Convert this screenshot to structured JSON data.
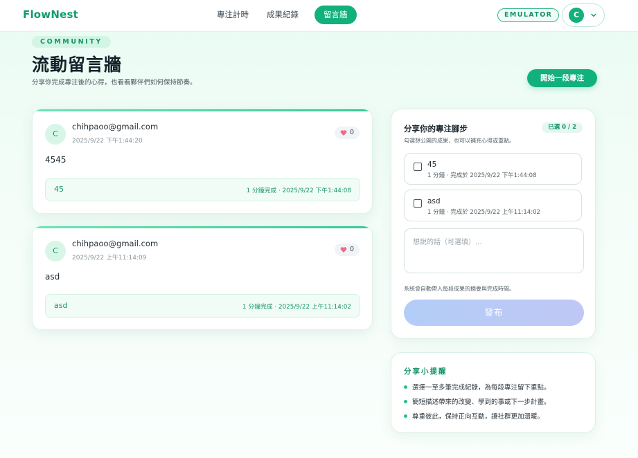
{
  "nav": {
    "brand": "FlowNest",
    "links": [
      "專注計時",
      "成果紀錄",
      "留言牆"
    ],
    "active_index": 2,
    "emulator_badge": "EMULATOR",
    "user_initial": "C"
  },
  "hero": {
    "eyebrow": "COMMUNITY",
    "title": "流動留言牆",
    "subtitle": "分享你完成專注後的心得，也看看夥伴們如何保持節奏。",
    "cta_label": "開始一段專注"
  },
  "posts": [
    {
      "avatar": "C",
      "author": "chihpaoo@gmail.com",
      "time": "2025/9/22 下午1:44:20",
      "likes": "0",
      "content": "4545",
      "attachment_title": "45",
      "attachment_meta": "1 分鐘完成 · 2025/9/22 下午1:44:08"
    },
    {
      "avatar": "C",
      "author": "chihpaoo@gmail.com",
      "time": "2025/9/22 上午11:14:09",
      "likes": "0",
      "content": "asd",
      "attachment_title": "asd",
      "attachment_meta": "1 分鐘完成 · 2025/9/22 上午11:14:02"
    }
  ],
  "share": {
    "title": "分享你的專注腳步",
    "hint": "勾選想公開的成果，也可以補充心得或重點。",
    "selected_badge": "已選 0 / 2",
    "options": [
      {
        "title": "45",
        "meta": "1 分鐘 · 完成於 2025/9/22 下午1:44:08",
        "checked": false
      },
      {
        "title": "asd",
        "meta": "1 分鐘 · 完成於 2025/9/22 上午11:14:02",
        "checked": false
      }
    ],
    "note_placeholder": "想說的話（可選填）...",
    "note_value": "",
    "auto_note": "系統會自動帶入每段成果的摘要與完成時間。",
    "publish_label": "發布"
  },
  "tips": {
    "title": "分享小提醒",
    "items": [
      "選擇一至多筆完成紀錄，為每段專注留下重點。",
      "簡短描述帶來的改變、學到的事或下一步計畫。",
      "尊重彼此，保持正向互動，讓社群更加溫暖。"
    ]
  },
  "colors": {
    "accent": "#12b07c",
    "accent_text": "#13936a",
    "heart": "#ef6b8a"
  }
}
